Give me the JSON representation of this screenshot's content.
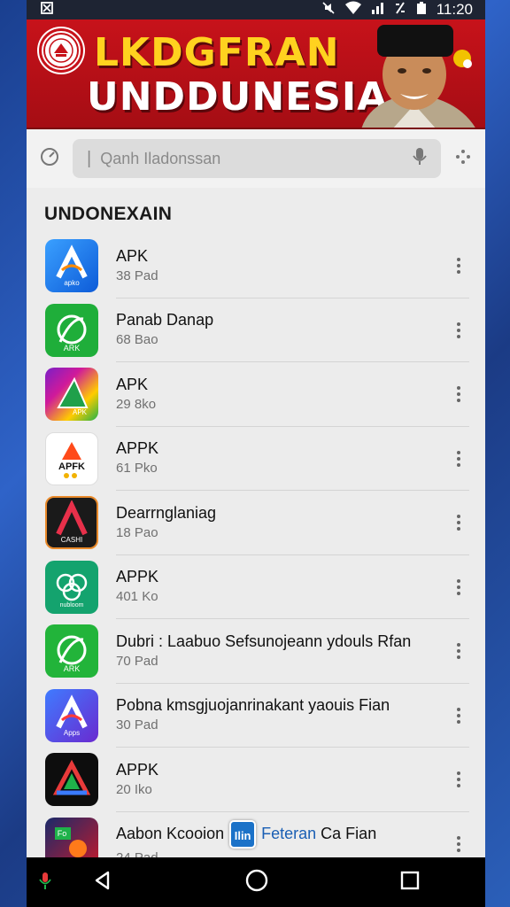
{
  "status_bar": {
    "time": "11:20",
    "icons": [
      "notification-icon",
      "silent-icon",
      "wifi-icon",
      "signal-icon",
      "data-icon",
      "battery-icon"
    ]
  },
  "banner": {
    "line1": "LKDGFRAN",
    "line2": "UNDDUNESIA",
    "colors": {
      "background": "#c7121a",
      "line1": "#ffd21f",
      "line2": "#ffffff"
    }
  },
  "search": {
    "placeholder": "Qanh Iladonssan"
  },
  "section": {
    "title": "UNDONEXAIN"
  },
  "apps": [
    {
      "name": "APK",
      "size": "38 Pad",
      "icon": "apk-blue-icon"
    },
    {
      "name": "Panab Danap",
      "size": "68 Bao",
      "icon": "green-leaf-icon"
    },
    {
      "name": "APK",
      "size": "29 8ko",
      "icon": "rainbow-apk-icon"
    },
    {
      "name": "APPK",
      "size": "61 Pko",
      "icon": "apfk-white-icon"
    },
    {
      "name": "Dearrnglaniag",
      "size": "18 Pao",
      "icon": "dark-a-icon"
    },
    {
      "name": "APPK",
      "size": "401 Ko",
      "icon": "teal-knot-icon"
    },
    {
      "name": "Dubri : Laabuo Sefsunojeann ydouls Rfan",
      "size": "70 Pad",
      "icon": "green-leaf-icon"
    },
    {
      "name": "Pobna kmsgjuojanrinakant yaouis Fian",
      "size": "30 Pad",
      "icon": "apk-blue-icon"
    },
    {
      "name": "APPK",
      "size": "20 Iko",
      "icon": "dark-triangle-icon"
    },
    {
      "name_pre": "Aabon Kcooion",
      "name_tag": "Ilin",
      "name_accent": "Feteran",
      "name_post": "Ca Fian",
      "size": "24 Pad",
      "icon": "colorful-game-icon"
    }
  ],
  "nav": {
    "buttons": [
      "back-icon",
      "home-icon",
      "recents-icon"
    ]
  }
}
